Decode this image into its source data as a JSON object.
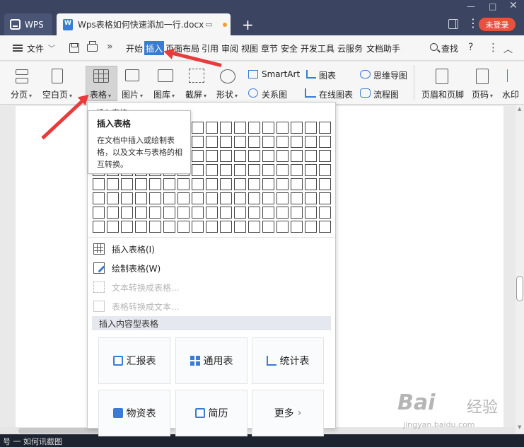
{
  "titlebar": {
    "home_tab": "WPS",
    "doc_tab": "Wps表格如何快速添加一行.docx",
    "login": "未登录",
    "add_tab": "+",
    "minimize": "—",
    "maximize": "□",
    "close": "✕"
  },
  "menubar": {
    "file": "文件",
    "tabs": [
      "开始",
      "插入",
      "页面布局",
      "引用",
      "审阅",
      "视图",
      "章节",
      "安全",
      "开发工具",
      "云服务",
      "文档助手"
    ],
    "active_tab": "插入",
    "search": "查找"
  },
  "ribbon": {
    "page_break": "分页",
    "blank_page": "空白页",
    "table": "表格",
    "picture": "图片",
    "gallery": "图库",
    "screenshot": "截屏",
    "shapes": "形状",
    "smartart": "SmartArt",
    "relation": "关系图",
    "chart": "图表",
    "online_chart": "在线图表",
    "mindmap": "思维导图",
    "flowchart": "流程图",
    "header_footer": "页眉和页脚",
    "page_number": "页码",
    "watermark": "水印"
  },
  "dropdown": {
    "header": "插入表格",
    "grid_rows": 8,
    "grid_cols": 17,
    "items": [
      {
        "label": "插入表格(I)",
        "enabled": true
      },
      {
        "label": "绘制表格(W)",
        "enabled": true
      },
      {
        "label": "文本转换成表格...",
        "enabled": false
      },
      {
        "label": "表格转换成文本...",
        "enabled": false
      }
    ],
    "content_header": "插入内容型表格",
    "cards": [
      "汇报表",
      "通用表",
      "统计表",
      "物资表",
      "简历",
      "更多"
    ]
  },
  "tooltip": {
    "title": "插入表格",
    "body": "在文档中插入或绘制表格，以及文本与表格的相互转换。"
  },
  "taskbar": {
    "text": "号 一 如何讯截图"
  },
  "watermark": {
    "logo": "Bai",
    "logo_cn": "经验",
    "url": "jingyan.baidu.com"
  },
  "colors": {
    "accent": "#3a7bd5",
    "titlebar": "#3b4460",
    "login": "#e5533d",
    "arrow": "#e83b3b"
  }
}
